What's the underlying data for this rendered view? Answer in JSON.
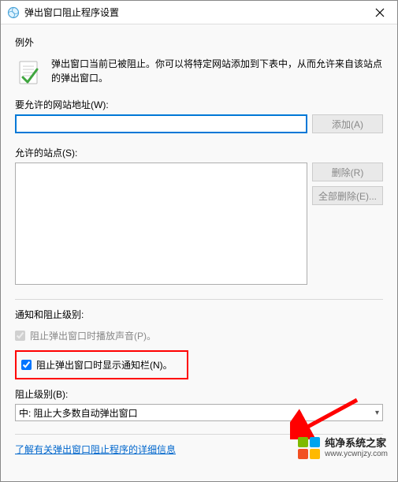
{
  "titlebar": {
    "title": "弹出窗口阻止程序设置"
  },
  "exceptions": {
    "heading": "例外",
    "intro": "弹出窗口当前已被阻止。你可以将特定网站添加到下表中，从而允许来自该站点的弹出窗口。",
    "address_label": "要允许的网站地址(W):",
    "add_label": "添加(A)",
    "sites_label": "允许的站点(S):",
    "remove_label": "删除(R)",
    "remove_all_label": "全部删除(E)..."
  },
  "notification": {
    "heading": "通知和阻止级别:",
    "sound_label": "阻止弹出窗口时播放声音(P)。",
    "notify_label": "阻止弹出窗口时显示通知栏(N)。",
    "level_label": "阻止级别(B):",
    "level_value": "中: 阻止大多数自动弹出窗口"
  },
  "link": {
    "label": "了解有关弹出窗口阻止程序的详细信息"
  },
  "watermark": {
    "line1": "纯净系统之家",
    "line2": "www.ycwnjzy.com"
  }
}
